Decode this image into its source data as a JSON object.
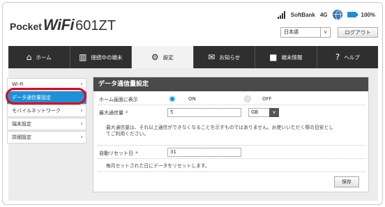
{
  "header": {
    "logo_pocket": "Pocket",
    "logo_wifi": "WiFi",
    "logo_model": "601ZT",
    "carrier": "SoftBank",
    "network": "4G",
    "battery": "100%",
    "language_selected": "日本語",
    "logout_label": "ログアウト"
  },
  "nav": {
    "tabs": [
      {
        "label": "ホーム",
        "icon": "home-icon",
        "glyph": "⌂"
      },
      {
        "label": "接続中の端末",
        "icon": "devices-icon",
        "glyph": "▥"
      },
      {
        "label": "設定",
        "icon": "gear-icon",
        "glyph": "⚙"
      },
      {
        "label": "お知らせ",
        "icon": "mail-icon",
        "glyph": "✉"
      },
      {
        "label": "端末情報",
        "icon": "device-info-icon",
        "glyph": "■"
      },
      {
        "label": "ヘルプ",
        "icon": "help-icon",
        "glyph": "?"
      }
    ],
    "active_tab": "設定"
  },
  "sidebar": {
    "items": [
      {
        "label": "Wi-Fi"
      },
      {
        "label": "データ通信量設定"
      },
      {
        "label": "モバイルネットワーク"
      },
      {
        "label": "端末設定"
      },
      {
        "label": "詳細設定"
      }
    ],
    "active_item": "データ通信量設定"
  },
  "panel": {
    "title": "データ通信量設定",
    "home_display_label": "ホーム画面に表示",
    "on_label": "ON",
    "off_label": "OFF",
    "home_display_value": "ON",
    "max_usage_label": "最大通信量",
    "max_usage_value": "5",
    "max_usage_unit": "GB",
    "max_usage_note_1": "最大通信量は、それ以上通信ができなくなることを示すものではありません。お使いいただく際の目安とし",
    "max_usage_note_2": "てご利用ください。",
    "auto_reset_label": "自動リセット日",
    "auto_reset_value": "31",
    "auto_reset_note": "毎月セットされた日にデータをリセットします。",
    "save_label": "保存"
  },
  "colors": {
    "accent": "#1e91d6",
    "nav_bg": "#2f2f2f",
    "highlight": "#e3001b"
  }
}
